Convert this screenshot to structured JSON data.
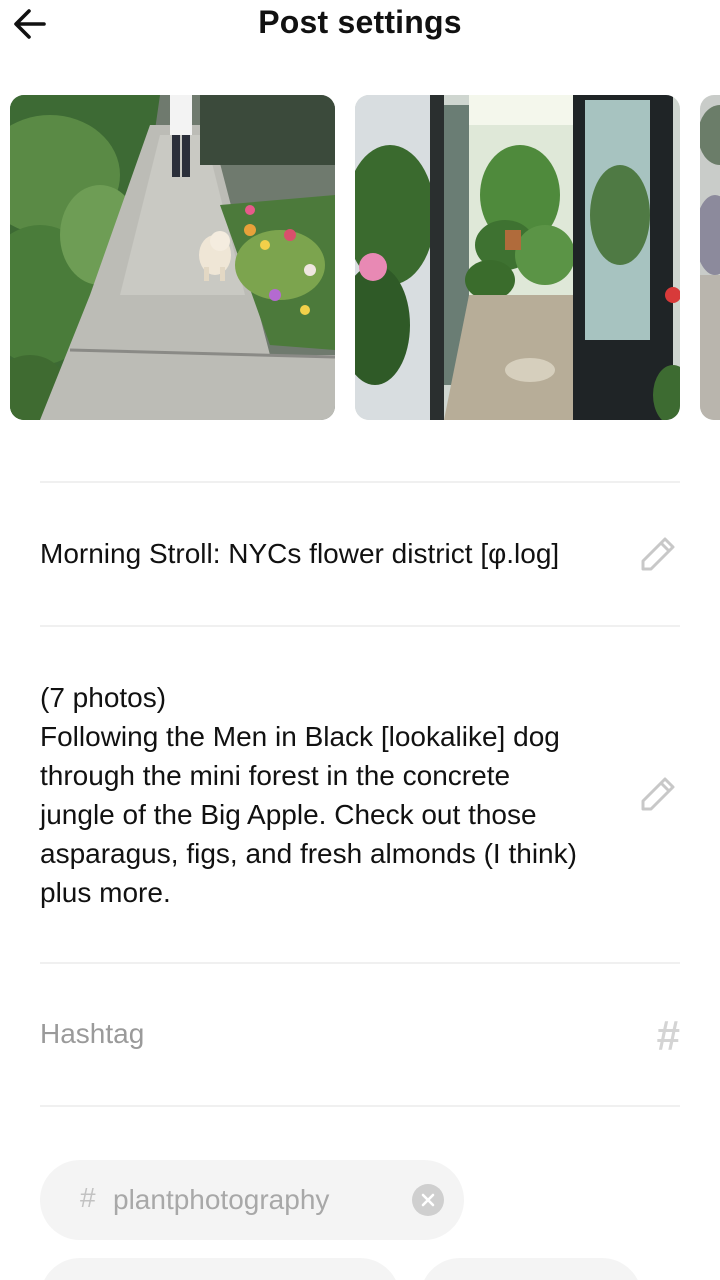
{
  "header": {
    "title": "Post settings",
    "back_icon": "arrow-left-icon"
  },
  "photos": [
    {
      "alt": "sidewalk-with-dog"
    },
    {
      "alt": "plant-shop-doorway"
    },
    {
      "alt": "partial-photo"
    }
  ],
  "post": {
    "title": "Morning Stroll: NYCs flower district [φ.log]",
    "description_lines": [
      "(7 photos)",
      "Following the Men in Black [lookalike] dog",
      "through the mini forest in the concrete",
      "jungle of the Big Apple. Check out those",
      "asparagus, figs, and fresh almonds (I think)",
      "plus more."
    ],
    "edit_icon": "pencil-icon"
  },
  "hashtag": {
    "placeholder": "Hashtag",
    "icon_glyph": "#",
    "icon": "hash-icon"
  },
  "chips": [
    {
      "hash": "#",
      "label": "plantphotography",
      "remove_icon": "close-circle-icon"
    }
  ],
  "colors": {
    "divider": "#f0f0f0",
    "chip_bg": "#f4f4f4",
    "placeholder": "#9a9a9a",
    "icon_gray": "#c8c8c8"
  }
}
